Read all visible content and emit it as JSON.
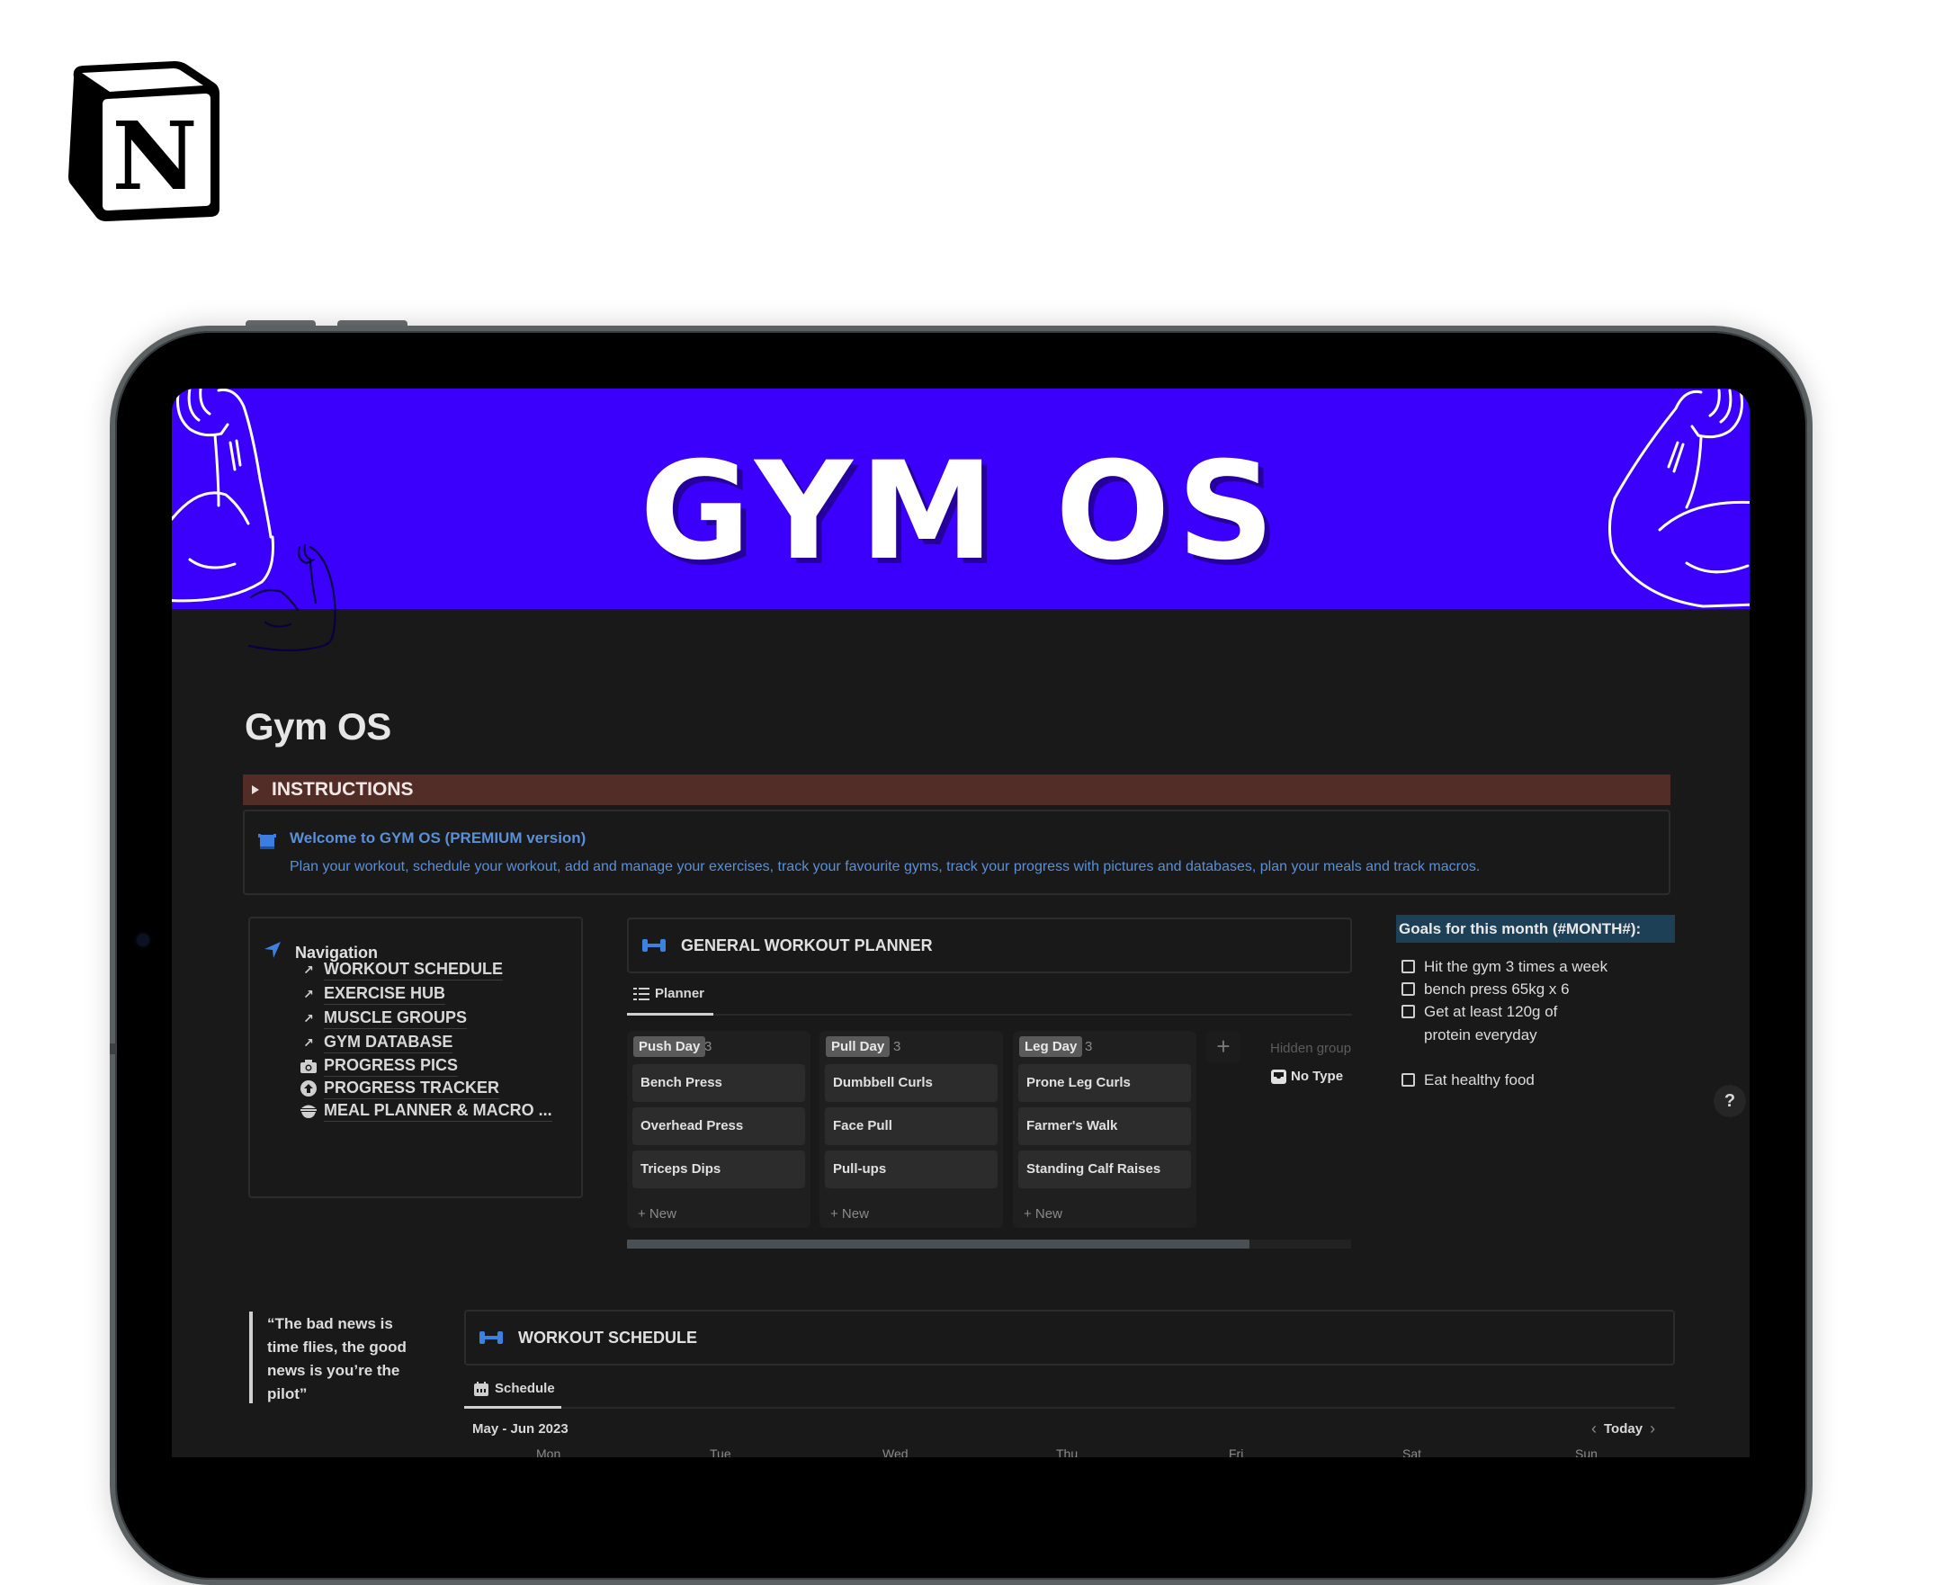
{
  "banner": {
    "title": "GYM OS",
    "color": "#3a00fb"
  },
  "page": {
    "title": "Gym OS"
  },
  "instructions": {
    "label": "INSTRUCTIONS",
    "color": "#522c26"
  },
  "callout": {
    "heading": "Welcome to GYM OS (PREMIUM version)",
    "body": "Plan your workout, schedule your workout, add and manage your exercises, track your favourite gyms, track your progress with pictures and databases, plan your meals and track macros.",
    "color": "#5b8fd6"
  },
  "navigation": {
    "heading": "Navigation",
    "items": [
      {
        "label": "WORKOUT SCHEDULE",
        "icon": "link-arrow-icon"
      },
      {
        "label": "EXERCISE HUB",
        "icon": "link-arrow-icon"
      },
      {
        "label": "MUSCLE GROUPS",
        "icon": "link-arrow-icon"
      },
      {
        "label": "GYM DATABASE",
        "icon": "link-arrow-icon"
      },
      {
        "label": "PROGRESS PICS",
        "icon": "camera-icon"
      },
      {
        "label": "PROGRESS TRACKER",
        "icon": "arrow-up-circle-icon"
      },
      {
        "label": "MEAL PLANNER & MACRO ...",
        "icon": "bowl-icon"
      }
    ]
  },
  "planner": {
    "title": "GENERAL WORKOUT PLANNER",
    "tab": "Planner",
    "columns": [
      {
        "name": "Push Day",
        "count": "3",
        "cards": [
          "Bench Press",
          "Overhead Press",
          "Triceps Dips"
        ],
        "new_label": "+ New"
      },
      {
        "name": "Pull Day",
        "count": "3",
        "cards": [
          "Dumbbell Curls",
          "Face Pull",
          "Pull-ups"
        ],
        "new_label": "+ New"
      },
      {
        "name": "Leg Day",
        "count": "3",
        "cards": [
          "Prone Leg Curls",
          "Farmer's Walk",
          "Standing Calf Raises"
        ],
        "new_label": "+ New"
      }
    ],
    "add_group": "+",
    "hidden_groups_label": "Hidden groups",
    "hidden_group_item": "No Type",
    "scroll_fraction": 0.86
  },
  "goals": {
    "heading": "Goals for this month (#MONTH#):",
    "items": [
      {
        "text": "Hit the gym 3 times a week",
        "checked": false
      },
      {
        "text": "bench press 65kg x 6",
        "checked": false
      },
      {
        "text": "Get at least 120g of protein everyday",
        "checked": false
      },
      {
        "text": "Eat healthy food",
        "checked": false
      }
    ]
  },
  "help": {
    "label": "?"
  },
  "quote": {
    "text": "“The bad news is time flies, the good news is you’re the pilot”"
  },
  "schedule": {
    "title": "WORKOUT SCHEDULE",
    "tab": "Schedule",
    "range": "May - Jun 2023",
    "prev": "‹",
    "today": "Today",
    "next": "›",
    "weekdays": [
      "Mon",
      "Tue",
      "Wed",
      "Thu",
      "Fri",
      "Sat",
      "Sun"
    ]
  }
}
